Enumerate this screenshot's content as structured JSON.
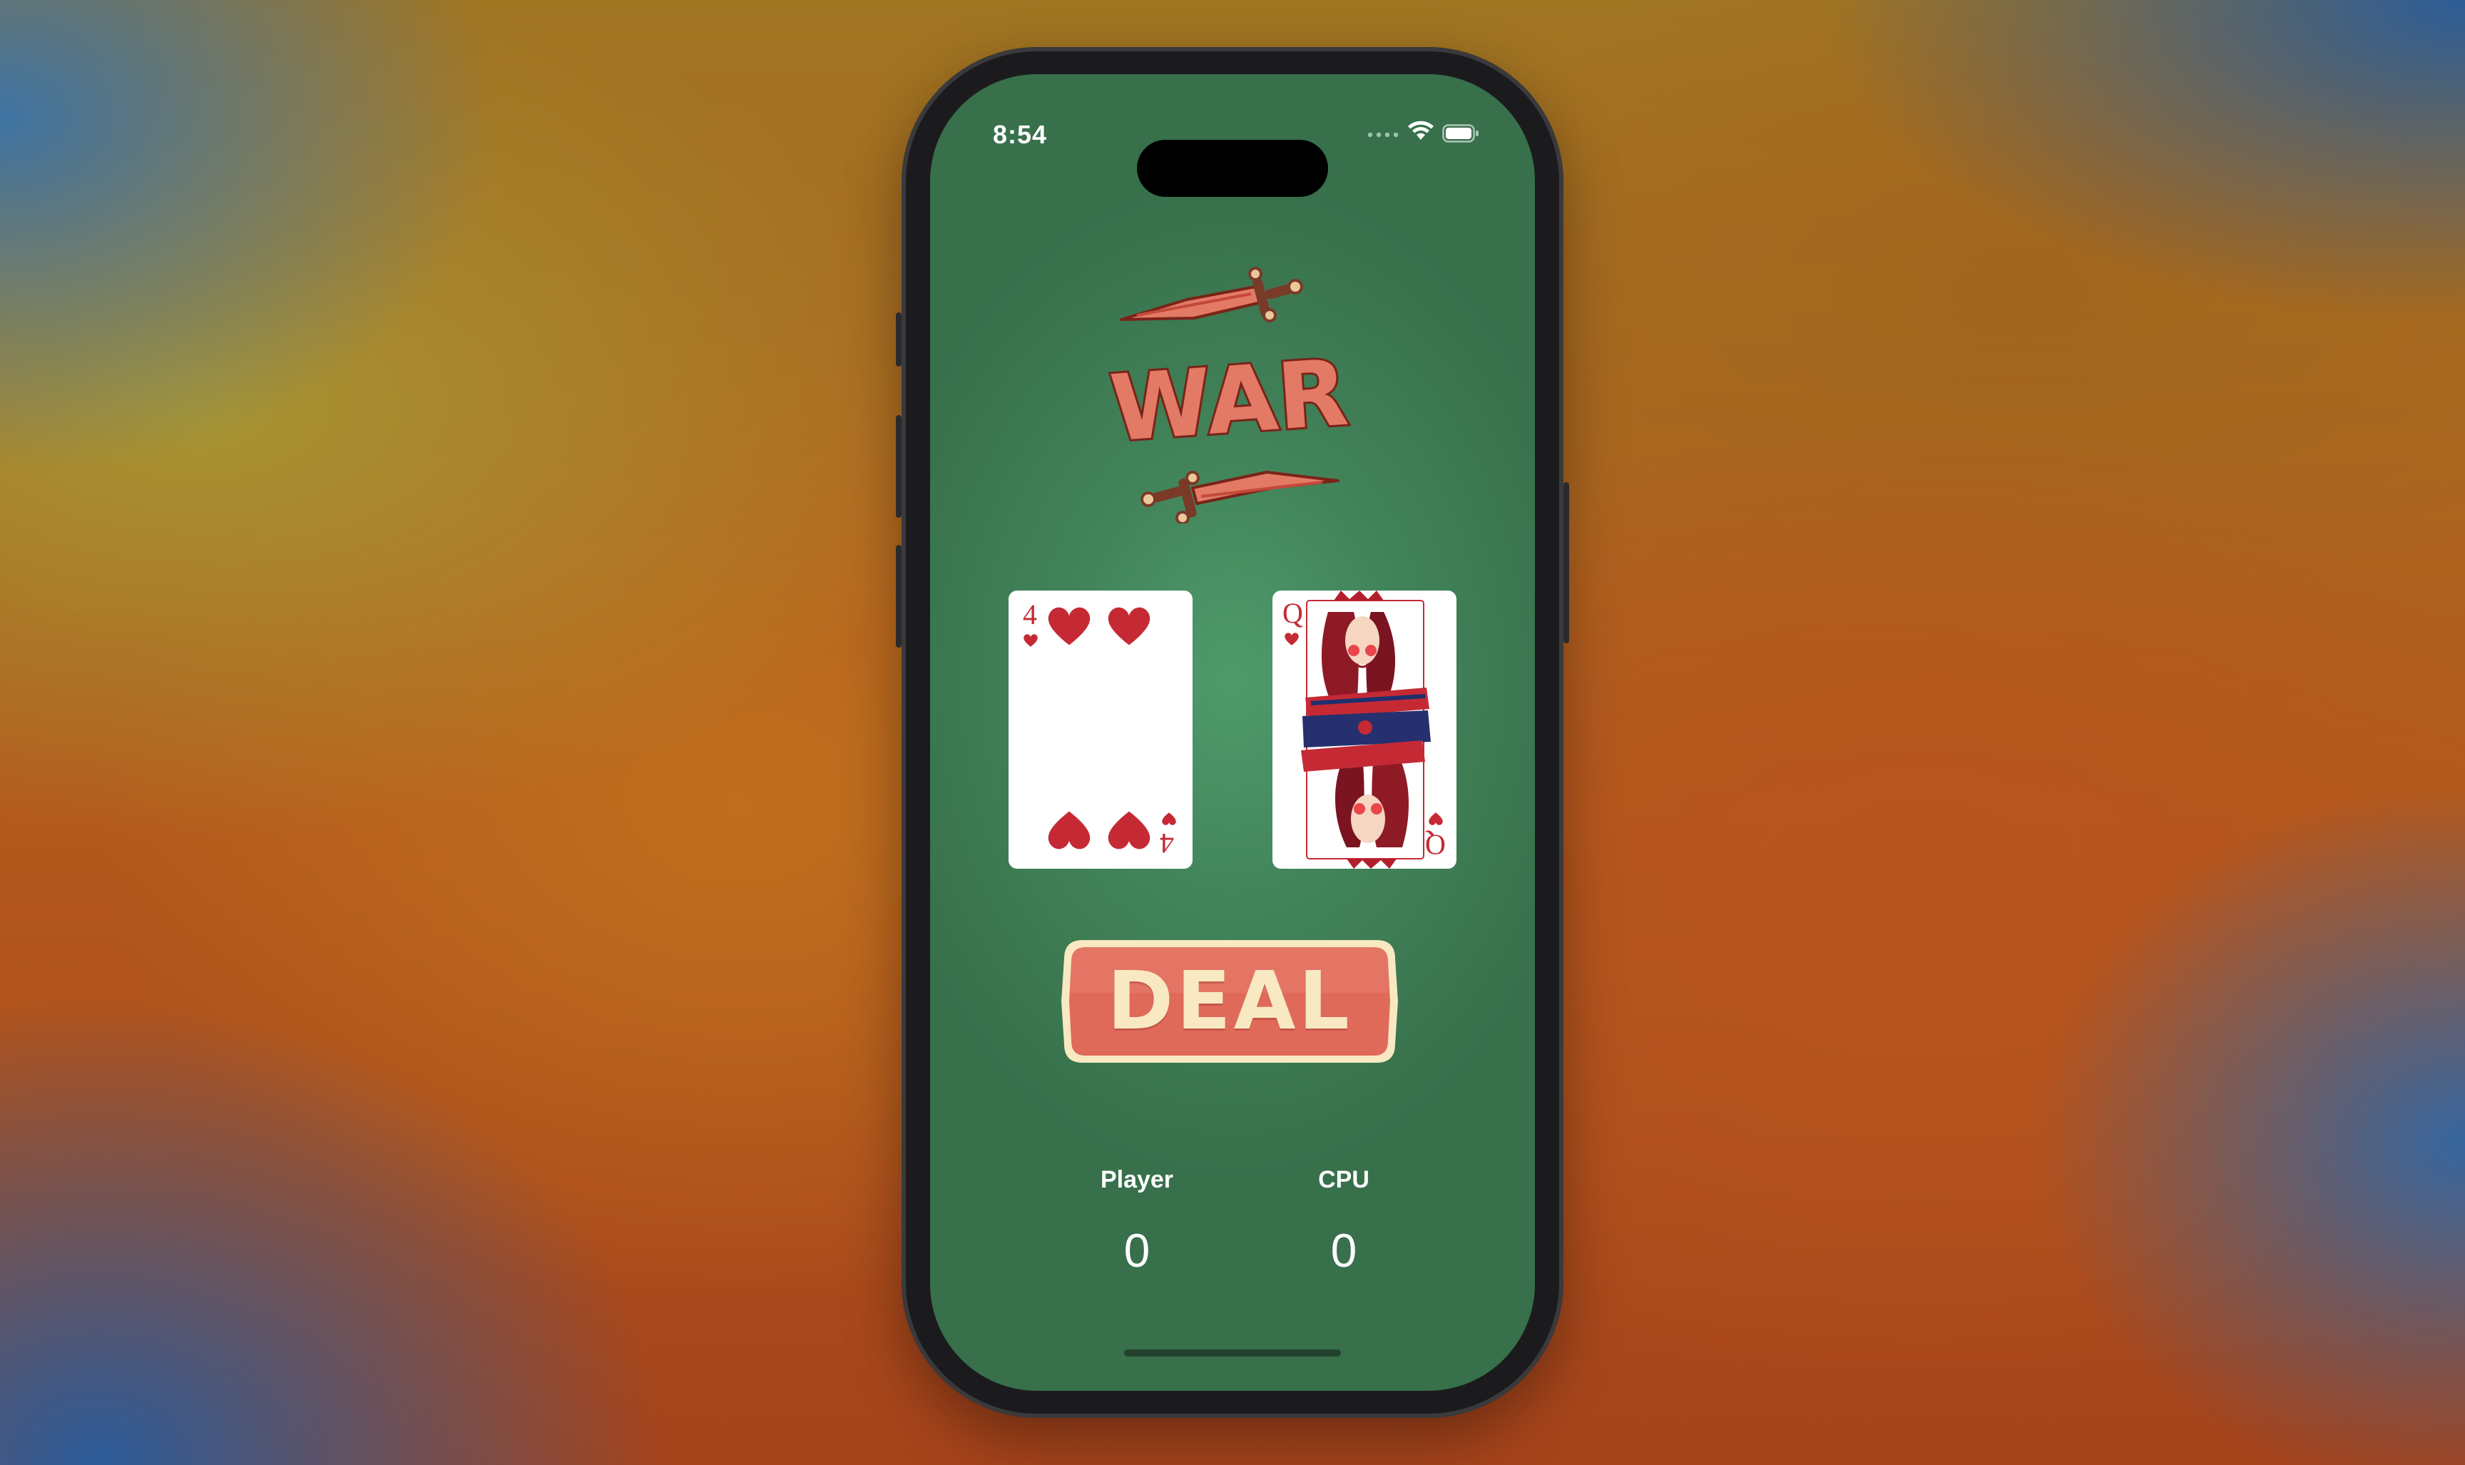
{
  "status_bar": {
    "time": "8:54",
    "wifi_icon": "wifi-icon",
    "battery_icon": "battery-icon"
  },
  "game": {
    "logo_text": "WAR",
    "player_card": {
      "rank": "4",
      "suit": "hearts"
    },
    "cpu_card": {
      "rank": "Q",
      "suit": "hearts"
    },
    "deal_label": "DEAL"
  },
  "scores": {
    "player_label": "Player",
    "player_score": "0",
    "cpu_label": "CPU",
    "cpu_score": "0"
  },
  "colors": {
    "table_green": "#4f9b6b",
    "button_red": "#e0685a",
    "button_cream": "#f8e9c2",
    "heart_red": "#c52a34"
  }
}
